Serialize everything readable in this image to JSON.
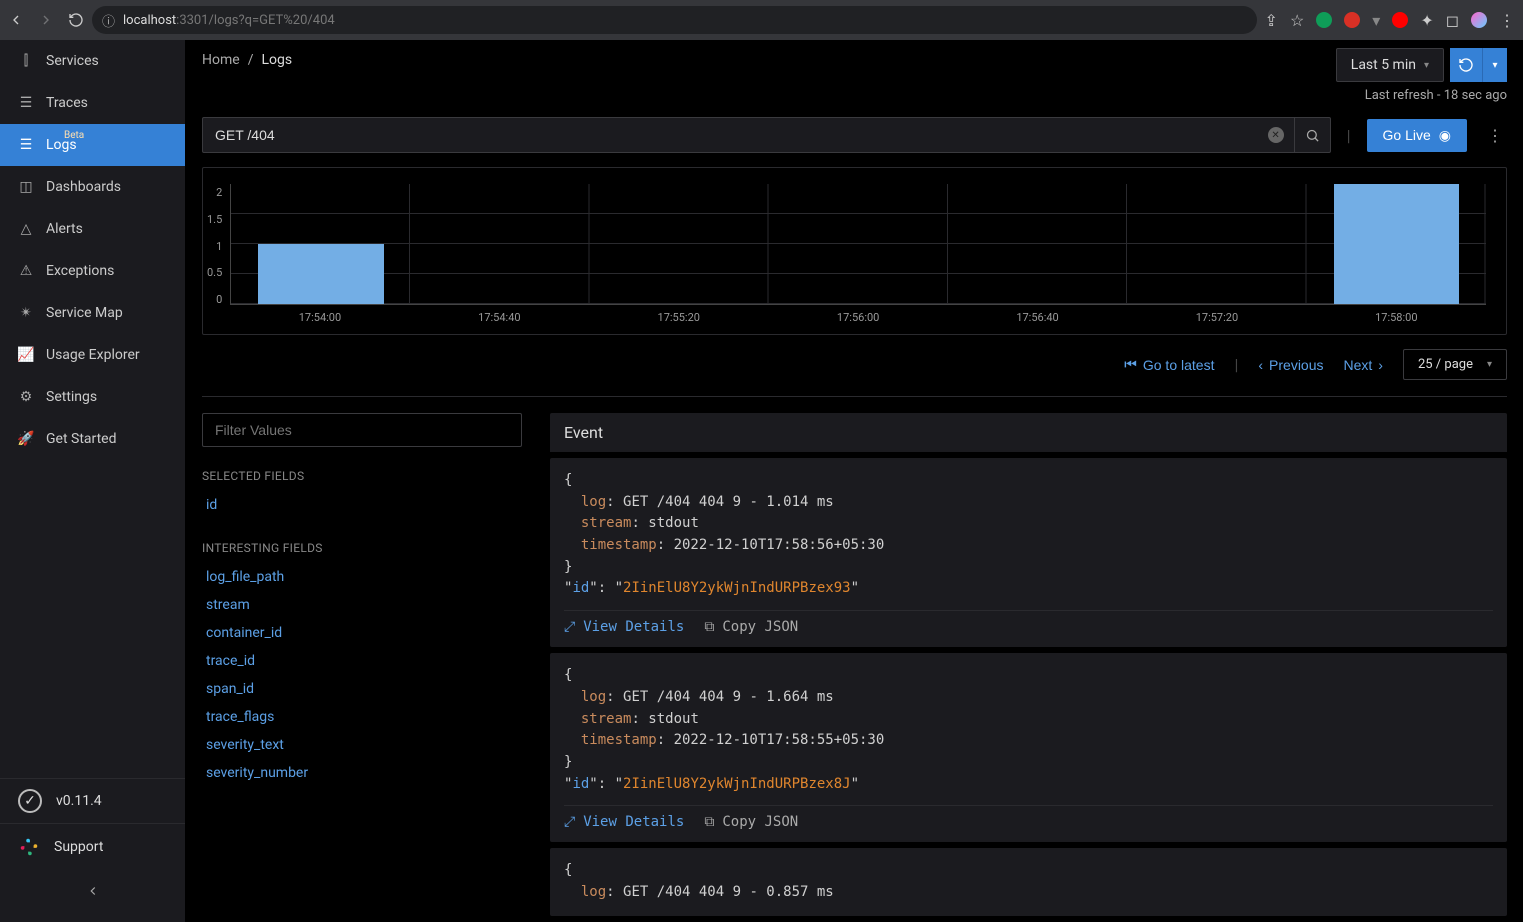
{
  "browser": {
    "url_scheme": "",
    "url_host": "localhost",
    "url_port": ":3301",
    "url_path": "/logs?q=GET%20/404"
  },
  "sidebar": {
    "items": [
      {
        "label": "Services",
        "icon": "bar-chart-icon"
      },
      {
        "label": "Traces",
        "icon": "menu-icon"
      },
      {
        "label": "Logs",
        "icon": "menu-icon",
        "badge": "Beta"
      },
      {
        "label": "Dashboards",
        "icon": "dashboard-icon"
      },
      {
        "label": "Alerts",
        "icon": "bell-icon"
      },
      {
        "label": "Exceptions",
        "icon": "warning-icon"
      },
      {
        "label": "Service Map",
        "icon": "graph-icon"
      },
      {
        "label": "Usage Explorer",
        "icon": "line-chart-icon"
      },
      {
        "label": "Settings",
        "icon": "gear-icon"
      },
      {
        "label": "Get Started",
        "icon": "rocket-icon"
      }
    ],
    "version": "v0.11.4",
    "support": "Support"
  },
  "header": {
    "breadcrumb": [
      "Home",
      "Logs"
    ],
    "time_range": "Last 5 min",
    "refresh_text": "Last refresh - 18 sec ago"
  },
  "search": {
    "value": "GET /404",
    "go_live": "Go Live"
  },
  "chart_data": {
    "type": "bar",
    "categories": [
      "17:54:00",
      "17:54:40",
      "17:55:20",
      "17:56:00",
      "17:56:40",
      "17:57:20",
      "17:58:00"
    ],
    "values": [
      1,
      0,
      0,
      0,
      0,
      0,
      2
    ],
    "ylim": [
      0,
      2
    ],
    "yticks": [
      "0",
      "0.5",
      "1",
      "1.5",
      "2"
    ]
  },
  "pagination": {
    "go_latest": "Go to latest",
    "previous": "Previous",
    "next": "Next",
    "page_size": "25 / page"
  },
  "fields": {
    "filter_placeholder": "Filter Values",
    "selected_heading": "SELECTED FIELDS",
    "selected": [
      "id"
    ],
    "interesting_heading": "INTERESTING FIELDS",
    "interesting": [
      "log_file_path",
      "stream",
      "container_id",
      "trace_id",
      "span_id",
      "trace_flags",
      "severity_text",
      "severity_number"
    ]
  },
  "events": {
    "heading": "Event",
    "view_details": "View Details",
    "copy_json": "Copy JSON",
    "items": [
      {
        "log": ": GET /404 404 9 - 1.014 ms",
        "stream": ": stdout",
        "timestamp": ": 2022-12-10T17:58:56+05:30",
        "id": "2IinElU8Y2ykWjnIndURPBzex93"
      },
      {
        "log": ": GET /404 404 9 - 1.664 ms",
        "stream": ": stdout",
        "timestamp": ": 2022-12-10T17:58:55+05:30",
        "id": "2IinElU8Y2ykWjnIndURPBzex8J"
      },
      {
        "log": ": GET /404 404 9 - 0.857 ms",
        "stream": "",
        "timestamp": "",
        "id": ""
      }
    ]
  }
}
